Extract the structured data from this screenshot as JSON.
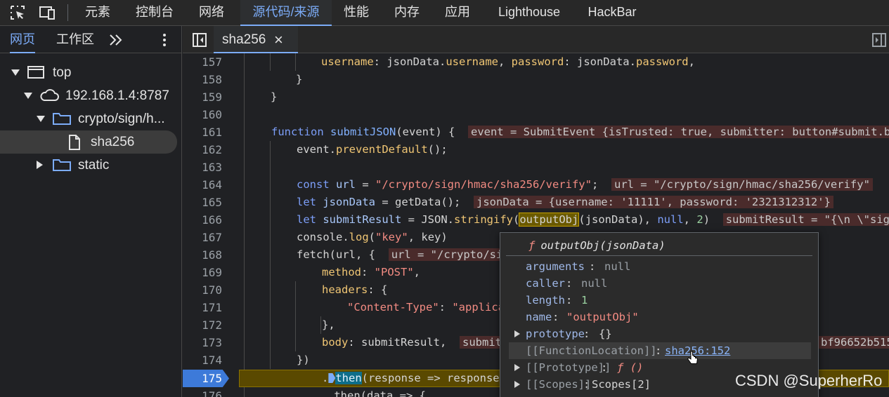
{
  "toolbar": {
    "icons": [
      "inspect-element-icon",
      "device-toolbar-icon"
    ],
    "tabs": [
      {
        "label": "元素"
      },
      {
        "label": "控制台"
      },
      {
        "label": "网络"
      },
      {
        "label": "源代码/来源",
        "active": true
      },
      {
        "label": "性能"
      },
      {
        "label": "内存"
      },
      {
        "label": "应用"
      },
      {
        "label": "Lighthouse"
      },
      {
        "label": "HackBar"
      }
    ],
    "accent_color": "#7cacf8"
  },
  "navigator": {
    "tabs": [
      {
        "label": "网页",
        "active": true
      },
      {
        "label": "工作区"
      }
    ],
    "more_icon": "double-chevron-right-icon",
    "menu_icon": "kebab-menu-icon",
    "tree": [
      {
        "label": "top",
        "icon": "frame-icon",
        "expanded": true
      },
      {
        "label": "192.168.1.4:8787",
        "icon": "cloud-icon",
        "expanded": true
      },
      {
        "label": "crypto/sign/h...",
        "icon": "folder-icon",
        "expanded": true
      },
      {
        "label": "sha256",
        "icon": "file-icon",
        "selected": true
      },
      {
        "label": "static",
        "icon": "folder-icon",
        "expanded": false
      }
    ]
  },
  "editor": {
    "toggle_icon": "toggle-navigator-icon",
    "file_tab": {
      "label": "sha256",
      "close": "×"
    },
    "right_icon": "toggle-debugger-icon",
    "paused_line": "175",
    "lines": [
      {
        "n": "157"
      },
      {
        "n": "158"
      },
      {
        "n": "159"
      },
      {
        "n": "160"
      },
      {
        "n": "161"
      },
      {
        "n": "162"
      },
      {
        "n": "163"
      },
      {
        "n": "164"
      },
      {
        "n": "165"
      },
      {
        "n": "166"
      },
      {
        "n": "167"
      },
      {
        "n": "168"
      },
      {
        "n": "169"
      },
      {
        "n": "170"
      },
      {
        "n": "171"
      },
      {
        "n": "172"
      },
      {
        "n": "173"
      },
      {
        "n": "174"
      },
      {
        "n": "175"
      },
      {
        "n": "176"
      }
    ],
    "code": {
      "l157_k1": "username",
      "l157_v1": "jsonData",
      "l157_p1": "username",
      "l157_k2": "password",
      "l157_v2": "jsonData",
      "l157_p2": "password",
      "l158": "}",
      "l159": "}",
      "l161_kw": "function",
      "l161_fn": "submitJSON",
      "l161_arg": "event",
      "l161_inline": "event = SubmitEvent  {isTrusted: true, submitter: button#submit.btn",
      "l162_obj": "event",
      "l162_fn": "preventDefault",
      "l162_tail": "();",
      "l164_kw": "const",
      "l164_var": "url",
      "l164_str": "\"/crypto/sign/hmac/sha256/verify\"",
      "l164_inline": "url = \"/crypto/sign/hmac/sha256/verify\"",
      "l165_kw": "let",
      "l165_var": "jsonData",
      "l165_fn": "getData",
      "l165_inline": "jsonData = {username: '11111', password: '2321312312'}",
      "l166_kw": "let",
      "l166_var": "submitResult",
      "l166_obj": "JSON",
      "l166_fn": "stringify",
      "l166_hover": "outputObj",
      "l166_arg": "jsonData",
      "l166_null": "null",
      "l166_num": "2",
      "l166_inline": "submitResult = \"{\\n \\\"signatu",
      "l167_obj": "console",
      "l167_fn": "log",
      "l167_str": "\"key\"",
      "l167_arg": "key",
      "l168_fn": "fetch",
      "l168_arg": "url",
      "l168_inline": "url = \"/crypto/sig",
      "l169_k": "method",
      "l169_v": "\"POST\"",
      "l170_k": "headers",
      "l171_k": "\"Content-Type\"",
      "l171_v": "\"applicat",
      "l172": "},",
      "l173_k": "body",
      "l173_v": "submitResult",
      "l173_inline": "submitR",
      "l173_tail": "bf96652b515",
      "l174": "})",
      "l175_then": "then",
      "l175_rest": "(response => response.",
      "l176": ".then(data => {"
    }
  },
  "popover": {
    "f_glyph": "ƒ",
    "title": "outputObj(jsonData)",
    "rows": [
      {
        "key": "arguments",
        "value": "null",
        "kind": "null"
      },
      {
        "key": "caller",
        "value": "null",
        "kind": "null"
      },
      {
        "key": "length",
        "value": "1",
        "kind": "num"
      },
      {
        "key": "name",
        "value": "\"outputObj\"",
        "kind": "str"
      },
      {
        "key": "prototype",
        "value": "{}",
        "kind": "plain",
        "expandable": true
      },
      {
        "key": "[[FunctionLocation]]",
        "value": "sha256:152",
        "kind": "link",
        "highlight": true
      },
      {
        "key": "[[Prototype]]",
        "value": "ƒ ()",
        "kind": "fn",
        "expandable": true
      },
      {
        "key": "[[Scopes]]",
        "value": "Scopes[2]",
        "kind": "plain",
        "expandable": true
      }
    ]
  },
  "watermark": "CSDN @SuperherRo"
}
